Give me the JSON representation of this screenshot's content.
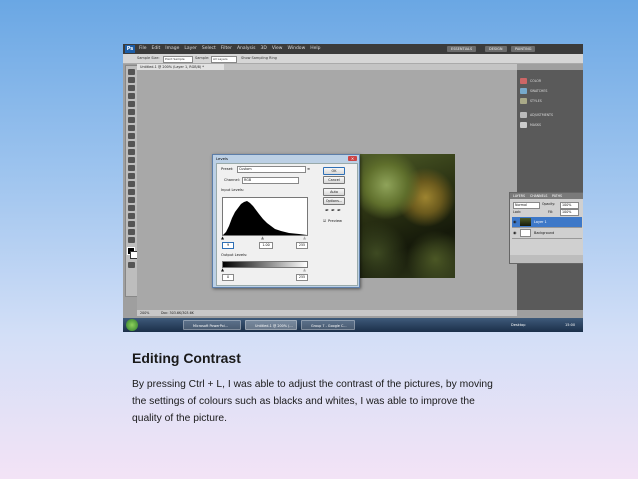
{
  "app": {
    "logo": "Ps",
    "menus": [
      "File",
      "Edit",
      "Image",
      "Layer",
      "Select",
      "Filter",
      "Analysis",
      "3D",
      "View",
      "Window",
      "Help"
    ],
    "workspace_buttons": [
      "ESSENTIALS",
      "DESIGN",
      "PAINTING"
    ],
    "options_bar": {
      "sample_size_label": "Sample Size:",
      "sample_size_value": "Point Sample",
      "sample_label": "Sample:",
      "sample_value": "All Layers",
      "show_ring": "Show Sampling Ring"
    },
    "doc_tab": "Untitled-1 @ 200% (Layer 1, RGB/8) *",
    "status": {
      "zoom": "200%",
      "doc": "Doc: 303.6K/303.6K"
    }
  },
  "levels_dialog": {
    "title": "Levels",
    "preset_label": "Preset:",
    "preset_value": "Custom",
    "channel_label": "Channel:",
    "channel_value": "RGB",
    "input_label": "Input Levels:",
    "input_values": [
      "9",
      "1.00",
      "255"
    ],
    "output_label": "Output Levels:",
    "output_values": [
      "0",
      "255"
    ],
    "buttons": [
      "OK",
      "Cancel",
      "Auto",
      "Options..."
    ],
    "preview_label": "Preview"
  },
  "panels": {
    "items": [
      "COLOR",
      "SWATCHES",
      "STYLES",
      "ADJUSTMENTS",
      "MASKS"
    ]
  },
  "layers_panel": {
    "tabs": [
      "LAYERS",
      "CHANNELS",
      "PATHS"
    ],
    "blend_mode": "Normal",
    "opacity_label": "Opacity:",
    "opacity_value": "100%",
    "lock_label": "Lock:",
    "fill_label": "Fill:",
    "fill_value": "100%",
    "layers": [
      "Layer 1",
      "Background"
    ]
  },
  "taskbar": {
    "buttons": [
      "Microsoft PowerPoi...",
      "Untitled-1 @ 200% (...",
      "Group 7 - Google C..."
    ],
    "desktop": "Desktop",
    "clock": "15:00"
  },
  "caption": {
    "title": "Editing Contrast",
    "body": "By pressing Ctrl + L, I was able to adjust the contrast of the pictures, by moving the settings of colours such as blacks and whites, I was able to improve the quality of the picture."
  }
}
